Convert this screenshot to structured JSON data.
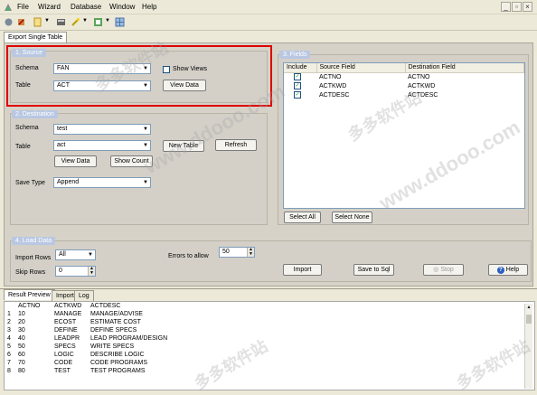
{
  "menubar": {
    "items": [
      "File",
      "Wizard",
      "Database",
      "Window",
      "Help"
    ]
  },
  "window_controls": [
    "_",
    "▫",
    "×"
  ],
  "tabs": {
    "main": "Export Single Table"
  },
  "source": {
    "title": "1. Source",
    "schema_label": "Schema",
    "schema_value": "FAN",
    "table_label": "Table",
    "table_value": "ACT",
    "show_views_label": "Show Views",
    "view_data_label": "View Data"
  },
  "destination": {
    "title": "2. Destination",
    "schema_label": "Schema",
    "schema_value": "test",
    "table_label": "Table",
    "table_value": "act",
    "new_table_label": "New Table",
    "refresh_label": "Refresh",
    "view_data_label": "View Data",
    "show_count_label": "Show Count",
    "save_type_label": "Save Type",
    "save_type_value": "Append"
  },
  "fields": {
    "title": "3. Fields",
    "headers": [
      "Include",
      "Source Field",
      "Destination Field"
    ],
    "rows": [
      {
        "source": "ACTNO",
        "dest": "ACTNO"
      },
      {
        "source": "ACTKWD",
        "dest": "ACTKWD"
      },
      {
        "source": "ACTDESC",
        "dest": "ACTDESC"
      }
    ],
    "select_all_label": "Select All",
    "select_none_label": "Select None"
  },
  "load": {
    "title": "4. Load Data",
    "import_rows_label": "Import Rows",
    "import_rows_value": "All",
    "skip_rows_label": "Skip Rows",
    "skip_rows_value": "0",
    "errors_label": "Errors to allow",
    "errors_value": "50",
    "import_label": "Import",
    "save_to_sql_label": "Save to Sql",
    "stop_label": "Stop",
    "help_label": "Help"
  },
  "bottom_tabs": [
    "Result Preview",
    "Import",
    "Log"
  ],
  "preview": {
    "headers": [
      "",
      "ACTNO",
      "ACTKWD",
      "ACTDESC"
    ],
    "rows": [
      [
        "1",
        "10",
        "MANAGE",
        "MANAGE/ADVISE"
      ],
      [
        "2",
        "20",
        "ECOST",
        "ESTIMATE COST"
      ],
      [
        "3",
        "30",
        "DEFINE",
        "DEFINE SPECS"
      ],
      [
        "4",
        "40",
        "LEADPR",
        "LEAD PROGRAM/DESIGN"
      ],
      [
        "5",
        "50",
        "SPECS",
        "WRITE SPECS"
      ],
      [
        "6",
        "60",
        "LOGIC",
        "DESCRIBE LOGIC"
      ],
      [
        "7",
        "70",
        "CODE",
        "CODE PROGRAMS"
      ],
      [
        "8",
        "80",
        "TEST",
        "TEST PROGRAMS"
      ]
    ]
  },
  "watermarks": [
    "多多软件站",
    "www.ddooo.com"
  ],
  "colors": {
    "highlight": "#e00000",
    "group_title": "#b9c7e2",
    "panel": "#d4d0c8"
  }
}
